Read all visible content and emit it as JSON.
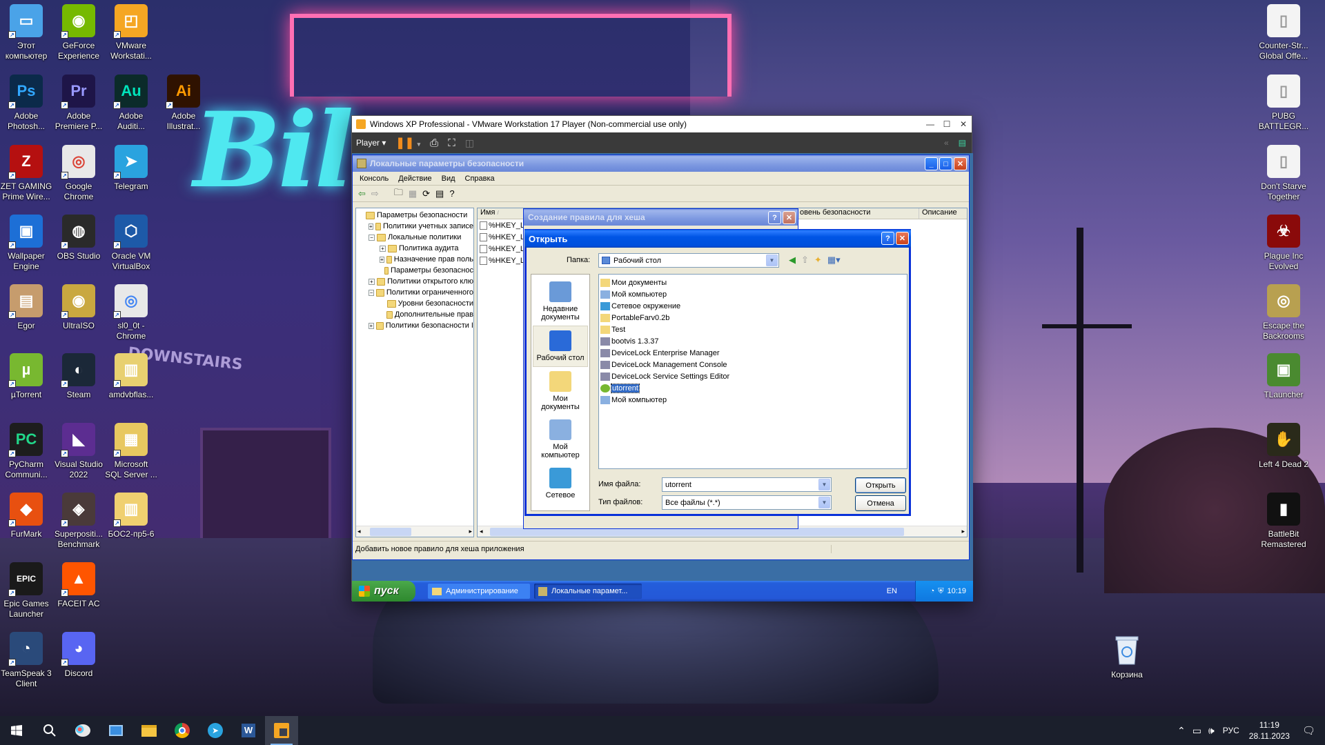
{
  "desktop": {
    "icons_left": [
      {
        "label": "Этот компьютер",
        "icon": "computer-icon",
        "color": "#4aa3e8",
        "glyph": "▭"
      },
      {
        "label": "GeForce Experience",
        "icon": "geforce-icon",
        "color": "#76b900",
        "glyph": "◉"
      },
      {
        "label": "VMware Workstati...",
        "icon": "vmware-icon",
        "color": "#f5a623",
        "glyph": "◰"
      },
      {
        "label": "Adobe Photosh...",
        "icon": "photoshop-icon",
        "color": "#0b2a4a",
        "glyph": "Ps",
        "fg": "#31a8ff"
      },
      {
        "label": "Adobe Premiere P...",
        "icon": "premiere-icon",
        "color": "#1e1548",
        "glyph": "Pr",
        "fg": "#9999ff"
      },
      {
        "label": "Adobe Auditi...",
        "icon": "audition-icon",
        "color": "#0b2b2a",
        "glyph": "Au",
        "fg": "#00e4bb"
      },
      {
        "label": "Adobe Illustrat...",
        "icon": "illustrator-icon",
        "color": "#2f1200",
        "glyph": "Ai",
        "fg": "#ff9a00"
      },
      {
        "label": "ZET GAMING Prime Wire...",
        "icon": "zet-gaming-icon",
        "color": "#b51010",
        "glyph": "Z"
      },
      {
        "label": "Google Chrome",
        "icon": "chrome-icon",
        "color": "#e8e8e8",
        "glyph": "◎",
        "fg": "#db4437"
      },
      {
        "label": "Telegram",
        "icon": "telegram-icon",
        "color": "#2aa3df",
        "glyph": "➤"
      },
      {
        "label": "Wallpaper Engine",
        "icon": "wallpaper-engine-icon",
        "color": "#1d6fd6",
        "glyph": "▣"
      },
      {
        "label": "OBS Studio",
        "icon": "obs-icon",
        "color": "#2a2a2a",
        "glyph": "◍"
      },
      {
        "label": "Oracle VM VirtualBox",
        "icon": "virtualbox-icon",
        "color": "#1d5aa8",
        "glyph": "⬡"
      },
      {
        "label": "Egor",
        "icon": "folder-icon",
        "color": "#c69c6d",
        "glyph": "▤"
      },
      {
        "label": "UltraISO",
        "icon": "ultraiso-icon",
        "color": "#c9a840",
        "glyph": "◉"
      },
      {
        "label": "sl0_0t - Chrome",
        "icon": "chrome-profile-icon",
        "color": "#e8e8e8",
        "glyph": "◎",
        "fg": "#4285f4"
      },
      {
        "label": "µTorrent",
        "icon": "utorrent-icon",
        "color": "#78b830",
        "glyph": "µ"
      },
      {
        "label": "Steam",
        "icon": "steam-icon",
        "color": "#1b2838",
        "glyph": "◐"
      },
      {
        "label": "amdvbflas...",
        "icon": "archive-icon",
        "color": "#e8d070",
        "glyph": "▥"
      },
      {
        "label": "PyCharm Communi...",
        "icon": "pycharm-icon",
        "color": "#1d1d1d",
        "glyph": "PC",
        "fg": "#21d789"
      },
      {
        "label": "Visual Studio 2022",
        "icon": "visual-studio-icon",
        "color": "#5c2d91",
        "glyph": "◣"
      },
      {
        "label": "Microsoft SQL Server ...",
        "icon": "sql-server-icon",
        "color": "#e8c860",
        "glyph": "▦"
      },
      {
        "label": "FurMark",
        "icon": "furmark-icon",
        "color": "#e85010",
        "glyph": "◆"
      },
      {
        "label": "Superpositi... Benchmark",
        "icon": "superposition-icon",
        "color": "#4a3a3a",
        "glyph": "◈"
      },
      {
        "label": "БОС2-пр5-6",
        "icon": "folder-zip-icon",
        "color": "#f0d070",
        "glyph": "▥"
      },
      {
        "label": "Epic Games Launcher",
        "icon": "epic-games-icon",
        "color": "#1a1a1a",
        "glyph": "EPIC"
      },
      {
        "label": "FACEIT AC",
        "icon": "faceit-icon",
        "color": "#ff5500",
        "glyph": "▲"
      },
      {
        "label": "TeamSpeak 3 Client",
        "icon": "teamspeak-icon",
        "color": "#2a4a7a",
        "glyph": "◔"
      },
      {
        "label": "Discord",
        "icon": "discord-icon",
        "color": "#5865f2",
        "glyph": "◕"
      }
    ],
    "icons_right": [
      {
        "label": "Counter-Str... Global Offe...",
        "icon": "file-icon",
        "color": "#f4f4f4",
        "glyph": "▯",
        "fg": "#999"
      },
      {
        "label": "PUBG BATTLEGR...",
        "icon": "file-icon",
        "color": "#f4f4f4",
        "glyph": "▯",
        "fg": "#999"
      },
      {
        "label": "Don't Starve Together",
        "icon": "file-icon",
        "color": "#f4f4f4",
        "glyph": "▯",
        "fg": "#999"
      },
      {
        "label": "Plague Inc Evolved",
        "icon": "plague-inc-icon",
        "color": "#8a0a0a",
        "glyph": "☣"
      },
      {
        "label": "Escape the Backrooms",
        "icon": "backrooms-icon",
        "color": "#b8a050",
        "glyph": "◎"
      },
      {
        "label": "TLauncher",
        "icon": "tlauncher-icon",
        "color": "#4a8a30",
        "glyph": "▣"
      },
      {
        "label": "Left 4 Dead 2",
        "icon": "left4dead-icon",
        "color": "#2a2a1a",
        "glyph": "✋"
      },
      {
        "label": "BattleBit Remastered",
        "icon": "battlebit-icon",
        "color": "#111",
        "glyph": "▮"
      }
    ],
    "recycle": {
      "label": "Корзина",
      "icon": "recycle-bin-icon"
    }
  },
  "taskbar": {
    "apps": [
      "start-icon",
      "search-icon",
      "paint-icon",
      "taskview-icon",
      "explorer-icon",
      "chrome-icon",
      "telegram-icon",
      "word-icon",
      "vmware-icon"
    ],
    "lang": "РУС",
    "time": "11:19",
    "date": "28.11.2023"
  },
  "vmware": {
    "title": "Windows XP Professional - VMware Workstation 17 Player (Non-commercial use only)",
    "player_label": "Player"
  },
  "mmc": {
    "title": "Локальные параметры безопасности",
    "menu": [
      "Консоль",
      "Действие",
      "Вид",
      "Справка"
    ],
    "tree": [
      {
        "label": "Параметры безопасности",
        "level": 0,
        "pm": ""
      },
      {
        "label": "Политики учетных записе",
        "level": 1,
        "pm": "+"
      },
      {
        "label": "Локальные политики",
        "level": 1,
        "pm": "−"
      },
      {
        "label": "Политика аудита",
        "level": 2,
        "pm": "+"
      },
      {
        "label": "Назначение прав поль",
        "level": 2,
        "pm": "+"
      },
      {
        "label": "Параметры безопаснос",
        "level": 2,
        "pm": ""
      },
      {
        "label": "Политики открытого клю",
        "level": 1,
        "pm": "+"
      },
      {
        "label": "Политики ограниченного",
        "level": 1,
        "pm": "−"
      },
      {
        "label": "Уровни безопасности",
        "level": 2,
        "pm": ""
      },
      {
        "label": "Дополнительные прав",
        "level": 2,
        "pm": ""
      },
      {
        "label": "Политики безопасности I",
        "level": 1,
        "pm": "+"
      }
    ],
    "list_headers": {
      "name": "Имя",
      "level": "овень безопасности",
      "desc": "Описание"
    },
    "list_rows": [
      "%HKEY_L",
      "%HKEY_L",
      "%HKEY_L",
      "%HKEY_L"
    ],
    "status": "Добавить новое правило для хеша приложения"
  },
  "hash_dialog": {
    "title": "Создание правила для хеша"
  },
  "open_dialog": {
    "title": "Открыть",
    "folder_label": "Папка:",
    "folder_value": "Рабочий стол",
    "places": [
      {
        "label": "Недавние документы",
        "icon": "recent-documents-icon"
      },
      {
        "label": "Рабочий стол",
        "icon": "desktop-icon"
      },
      {
        "label": "Мои документы",
        "icon": "my-documents-icon"
      },
      {
        "label": "Мой компьютер",
        "icon": "my-computer-icon"
      },
      {
        "label": "Сетевое",
        "icon": "network-icon"
      }
    ],
    "files": [
      {
        "name": "Мои документы",
        "icon": "folder-icon",
        "selected": false
      },
      {
        "name": "Мой компьютер",
        "icon": "my-computer-icon",
        "selected": false
      },
      {
        "name": "Сетевое окружение",
        "icon": "network-icon",
        "selected": false
      },
      {
        "name": "PortableFarv0.2b",
        "icon": "folder-icon",
        "selected": false
      },
      {
        "name": "Test",
        "icon": "folder-icon",
        "selected": false
      },
      {
        "name": "bootvis 1.3.37",
        "icon": "shortcut-icon",
        "selected": false
      },
      {
        "name": "DeviceLock Enterprise Manager",
        "icon": "shortcut-icon",
        "selected": false
      },
      {
        "name": "DeviceLock Management Console",
        "icon": "shortcut-icon",
        "selected": false
      },
      {
        "name": "DeviceLock Service Settings Editor",
        "icon": "shortcut-icon",
        "selected": false
      },
      {
        "name": "utorrent",
        "icon": "utorrent-icon",
        "selected": true
      },
      {
        "name": "Мой компьютер",
        "icon": "my-computer-icon",
        "selected": false
      }
    ],
    "filename_label": "Имя файла:",
    "filename_value": "utorrent",
    "filetype_label": "Тип файлов:",
    "filetype_value": "Все файлы (*.*)",
    "open_button": "Открыть",
    "cancel_button": "Отмена"
  },
  "xp_taskbar": {
    "start": "пуск",
    "tasks": [
      "Администрирование",
      "Локальные парамет..."
    ],
    "lang": "EN",
    "time": "10:19"
  }
}
